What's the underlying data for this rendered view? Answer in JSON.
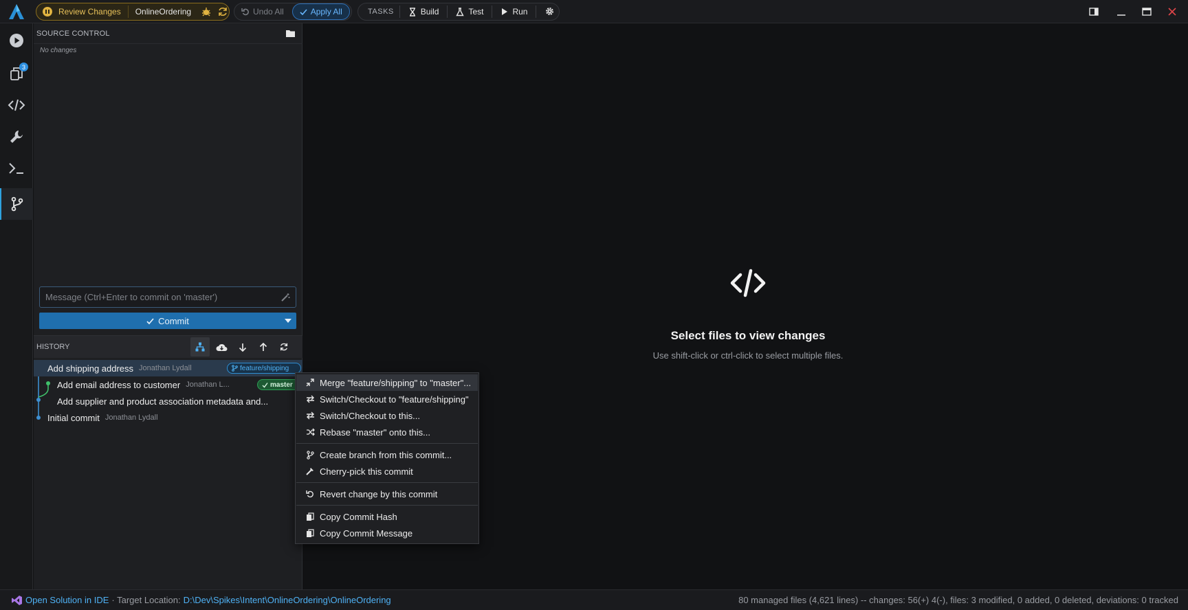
{
  "toolbar": {
    "review_label": "Review Changes",
    "project_name": "OnlineOrdering",
    "undo_label": "Undo All",
    "apply_label": "Apply All",
    "tasks_label": "TASKS",
    "build_label": "Build",
    "test_label": "Test",
    "run_label": "Run"
  },
  "activity_bar": {
    "changes_badge": "3"
  },
  "source_control": {
    "header": "SOURCE CONTROL",
    "empty_text": "No changes",
    "message_placeholder": "Message (Ctrl+Enter to commit on 'master')",
    "commit_label": "Commit"
  },
  "history": {
    "header": "HISTORY",
    "commits": [
      {
        "message": "Add shipping address",
        "author": "Jonathan Lydall",
        "tag": "feature/shipping"
      },
      {
        "message": "Add email address to customer",
        "author": "Jonathan L...",
        "tag": "master"
      },
      {
        "message": "Add supplier and product association metadata and...",
        "author": ""
      },
      {
        "message": "Initial commit",
        "author": "Jonathan Lydall"
      }
    ]
  },
  "editor": {
    "empty_title": "Select files to view changes",
    "empty_subtitle": "Use shift-click or ctrl-click to select multiple files."
  },
  "context_menu": {
    "items": [
      {
        "label": "Merge \"feature/shipping\" to \"master\"...",
        "icon": "merge-icon"
      },
      {
        "label": "Switch/Checkout to \"feature/shipping\"",
        "icon": "swap-icon"
      },
      {
        "label": "Switch/Checkout to this...",
        "icon": "swap-icon"
      },
      {
        "label": "Rebase \"master\" onto this...",
        "icon": "shuffle-icon"
      },
      {
        "label": "Create branch from this commit...",
        "icon": "branch-icon"
      },
      {
        "label": "Cherry-pick this commit",
        "icon": "cherry-pick-icon"
      },
      {
        "label": "Revert change by this commit",
        "icon": "revert-icon"
      },
      {
        "label": "Copy Commit Hash",
        "icon": "copy-icon"
      },
      {
        "label": "Copy Commit Message",
        "icon": "copy-icon"
      }
    ]
  },
  "status_bar": {
    "open_ide": "Open Solution in IDE",
    "target_prefix": "· Target Location:",
    "target_path": "D:\\Dev\\Spikes\\Intent\\OnlineOrdering\\OnlineOrdering",
    "summary": "80 managed files (4,621 lines) -- changes: 56(+) 4(-), files: 3 modified, 0 added, 0 deleted, deviations: 0 tracked"
  },
  "colors": {
    "accent": "#2ea3e0",
    "review": "#e0b341",
    "commit_button": "#1f6fae",
    "master_tag": "#1d5a33"
  }
}
